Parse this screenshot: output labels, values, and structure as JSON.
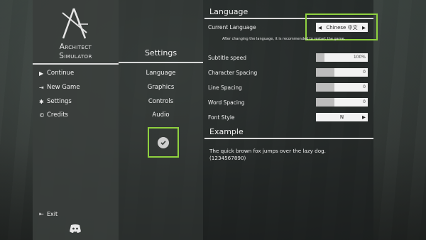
{
  "logo": {
    "line1": "Architect",
    "line2": "Simulator"
  },
  "main_menu": {
    "items": [
      {
        "label": "Continue",
        "icon": "play-icon"
      },
      {
        "label": "New Game",
        "icon": "enter-icon"
      },
      {
        "label": "Settings",
        "icon": "gear-icon"
      },
      {
        "label": "Credits",
        "icon": "copyright-icon"
      }
    ],
    "exit_label": "Exit",
    "discord_icon": "discord-icon"
  },
  "settings_menu": {
    "title": "Settings",
    "items": [
      "Language",
      "Graphics",
      "Controls",
      "Audio"
    ],
    "confirm_icon": "checkmark-icon"
  },
  "language_section": {
    "title": "Language",
    "current_language_label": "Current Language",
    "current_language_value": "Chinese 中文",
    "restart_note": "After changing the language, it is recommended to restart the game.",
    "subtitle_speed_label": "Subtitle speed",
    "subtitle_speed_value": "100%",
    "subtitle_speed_fraction": 0.0,
    "character_spacing_label": "Character Spacing",
    "character_spacing_value": "0",
    "line_spacing_label": "Line Spacing",
    "line_spacing_value": "0",
    "word_spacing_label": "Word Spacing",
    "word_spacing_value": "0",
    "font_style_label": "Font Style",
    "font_style_value": "N"
  },
  "example_section": {
    "title": "Example",
    "line1": "The quick brown fox jumps over the lazy dog.",
    "line2": "(1234567890)"
  },
  "colors": {
    "highlight": "#8fd13f",
    "panel_left": "#3a3e3c"
  }
}
